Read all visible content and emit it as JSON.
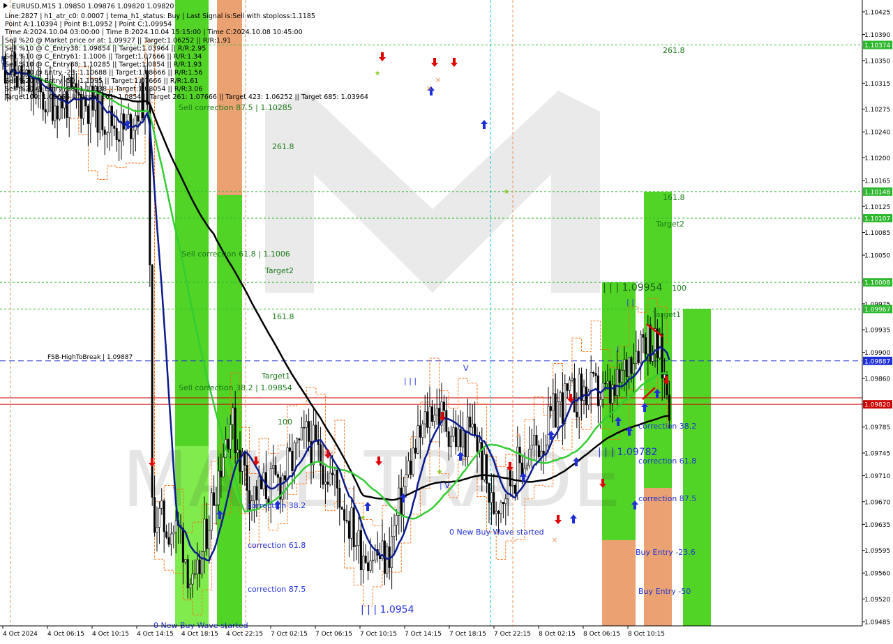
{
  "header": {
    "symbol_line": "EURUSD,M15  1.09850 1.09876 1.09820 1.09820",
    "info_lines": [
      "Line:2827  |  h1_atr_c0: 0.0007  |  tema_h1_status: Buy  |  Last Signal is:Sell with stoploss:1.1185",
      "Point A:1.10394  |  Point B:1.0952  |  Point C:1.09954",
      "Time A:2024.10.04 03:00:00  |  Time B:2024.10.04 15:15:00  |  Time C:2024.10.08 10:45:00",
      "Sell %20 @ Market price or at: 1.09927  ||  Target:1.06252  ||  R/R:1.91",
      "Sell %10 @ C_Entry38: 1.09854  ||  Target:1.03964  ||  R/R:2.95",
      "Sell %10 @ C_Entry61: 1.1006  ||  Target:1.07666  ||  R/R:1.34",
      "Sell %10 @ C_Entry88: 1.10285  ||  Target:1.0854  ||  R/R:1.93",
      "Sell %10 @ Entry -23: 1.10688  ||  Target:1.08666  ||  R/R:1.56",
      "Sell %20 @ Entry -50: 1.1095  ||  Target:1.07666  ||  R/R:1.61",
      "Sell %20 @ Entry -88: 1.11338  ||  Target:1.08054  ||  R/R:3.06",
      "Target100: 1.08666  ||  Target 161: 1.0854  ||  Target 261: 1.07666  ||  Target 423: 1.06252  ||  Target 685: 1.03964"
    ]
  },
  "chart_data": {
    "type": "candlestick",
    "symbol": "EURUSD",
    "timeframe": "M15",
    "ylim": [
      1.09485,
      1.1046
    ],
    "price_ticks": [
      "1.10425",
      "1.10390",
      "1.10350",
      "1.10315",
      "1.10275",
      "1.10240",
      "1.10200",
      "1.10165",
      "1.10125",
      "1.10085",
      "1.10050",
      "1.10010",
      "1.09975",
      "1.09935",
      "1.09900",
      "1.09860",
      "1.09820",
      "1.09785",
      "1.09745",
      "1.09710",
      "1.09670",
      "1.09635",
      "1.09595",
      "1.09560",
      "1.09520",
      "1.09485"
    ],
    "time_labels": [
      "4 Oct 2024",
      "4 Oct 06:15",
      "4 Oct 10:15",
      "4 Oct 14:15",
      "4 Oct 18:15",
      "4 Oct 22:15",
      "7 Oct 02:15",
      "7 Oct 06:15",
      "7 Oct 10:15",
      "7 Oct 14:15",
      "7 Oct 18:15",
      "7 Oct 22:15",
      "8 Oct 02:15",
      "8 Oct 06:15",
      "8 Oct 10:15"
    ],
    "current_price": "1.09820",
    "price_badges": [
      {
        "label": "1.10374",
        "value": 1.10374,
        "color": "#2eb82e"
      },
      {
        "label": "1.10148",
        "value": 1.10148,
        "color": "#2eb82e"
      },
      {
        "label": "1.10107",
        "value": 1.10107,
        "color": "#2eb82e"
      },
      {
        "label": "1.10008",
        "value": 1.10008,
        "color": "#2eb82e"
      },
      {
        "label": "1.09967",
        "value": 1.09967,
        "color": "#2eb82e"
      },
      {
        "label": "1.09887",
        "value": 1.09887,
        "color": "#1f2fd6"
      },
      {
        "label": "1.09820",
        "value": 1.0982,
        "color": "#cc0000"
      }
    ],
    "fsb_line": {
      "label": "FSB-HighToBreak  |  1.09887",
      "value": 1.09887
    },
    "annotations": [
      {
        "text": "Sell correction 87.5 | 1.10285",
        "color": "#1a7a1a"
      },
      {
        "text": "261.8",
        "color": "#1a7a1a"
      },
      {
        "text": "Sell correction 61.8 | 1.1006",
        "color": "#1a7a1a"
      },
      {
        "text": "Target2",
        "color": "#1a7a1a"
      },
      {
        "text": "161.8",
        "color": "#1a7a1a"
      },
      {
        "text": "Target1",
        "color": "#1a7a1a"
      },
      {
        "text": "Sell correction 38.2 | 1.09854",
        "color": "#1a7a1a"
      },
      {
        "text": "100",
        "color": "#1a7a1a"
      },
      {
        "text": "261.8",
        "color": "#1a7a1a"
      },
      {
        "text": "161.8",
        "color": "#1a7a1a"
      },
      {
        "text": "Target2",
        "color": "#1a7a1a"
      },
      {
        "text": "100",
        "color": "#1a7a1a"
      },
      {
        "text": "Target1",
        "color": "#1a7a1a"
      },
      {
        "text": "correction 38.2",
        "color": "#1f2fd6"
      },
      {
        "text": "correction 61.8",
        "color": "#1f2fd6"
      },
      {
        "text": "correction 87.5",
        "color": "#1f2fd6"
      },
      {
        "text": "correction 38.2",
        "color": "#1f2fd6"
      },
      {
        "text": "correction 61.8",
        "color": "#1f2fd6"
      },
      {
        "text": "correction 87.5",
        "color": "#1f2fd6"
      },
      {
        "text": "Buy Entry -23.6",
        "color": "#1f2fd6"
      },
      {
        "text": "Buy Entry -50",
        "color": "#1f2fd6"
      },
      {
        "text": "0 New Buy Wave started",
        "color": "#1f2fd6"
      },
      {
        "text": "0 New Buy Wave started",
        "color": "#1f2fd6"
      },
      {
        "text": "| | | 1.0954",
        "color": "#1f2fd6"
      },
      {
        "text": "| | | 1.09782",
        "color": "#1f2fd6"
      },
      {
        "text": "| | | 1.09954",
        "color": "#1a5a1a"
      },
      {
        "text": "| V",
        "color": "#1f2fd6"
      },
      {
        "text": "V",
        "color": "#1f2fd6"
      },
      {
        "text": "| | |",
        "color": "#1f2fd6"
      },
      {
        "text": "|",
        "color": "#1f2fd6"
      },
      {
        "text": "I",
        "color": "#1f2fd6"
      },
      {
        "text": "| |",
        "color": "#1f2fd6"
      }
    ],
    "colors": {
      "bull": "#2eb82e",
      "bear": "#000000",
      "ma_black": "#000000",
      "ma_green": "#33cc33",
      "ma_navy": "#0a1a8c",
      "zone_green": "#33cc00",
      "zone_orange": "#e8925a"
    }
  }
}
